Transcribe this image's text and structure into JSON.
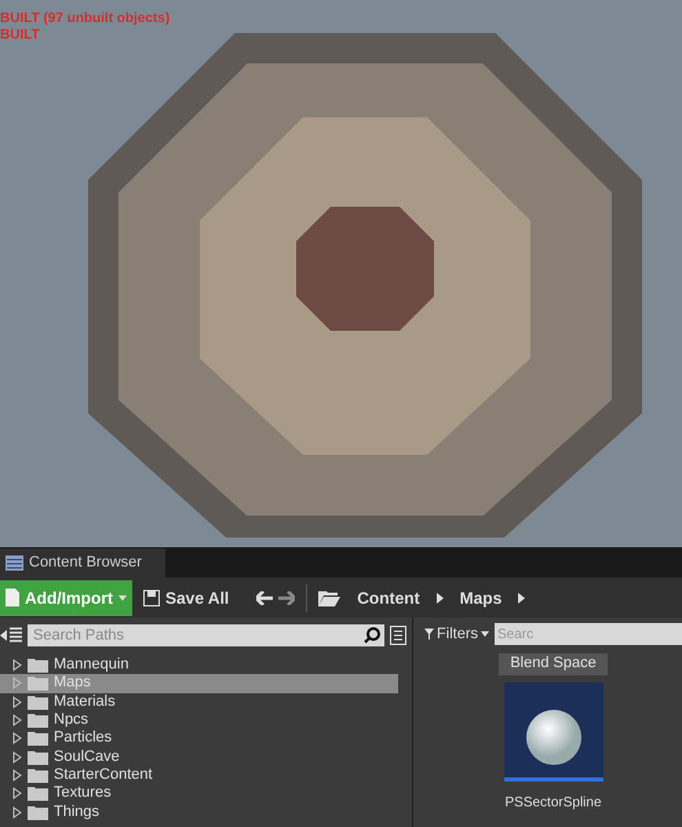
{
  "viewport": {
    "overlay_lines": [
      "BUILT (97 unbuilt objects)",
      "BUILT"
    ]
  },
  "tab": {
    "title": "Content Browser",
    "selected": true
  },
  "toolbar": {
    "add_button": "Add/Import",
    "save_button": "Save All",
    "path": [
      "Content",
      "Maps"
    ]
  },
  "sources": {
    "search": {
      "placeholder": "Search Paths"
    },
    "folders": [
      {
        "name": "Mannequin",
        "selected": false
      },
      {
        "name": "Maps",
        "selected": true
      },
      {
        "name": "Materials",
        "selected": false
      },
      {
        "name": "Npcs",
        "selected": false
      },
      {
        "name": "Particles",
        "selected": false
      },
      {
        "name": "SoulCave",
        "selected": false
      },
      {
        "name": "StarterContent",
        "selected": false
      },
      {
        "name": "Textures",
        "selected": false
      },
      {
        "name": "Things",
        "selected": false
      }
    ]
  },
  "assets": {
    "filters_button": "Filters",
    "search": {
      "placeholder": "Searc"
    },
    "filter_chip": "Blend Space",
    "items": [
      {
        "name": "PSSectorSpline"
      }
    ]
  }
}
